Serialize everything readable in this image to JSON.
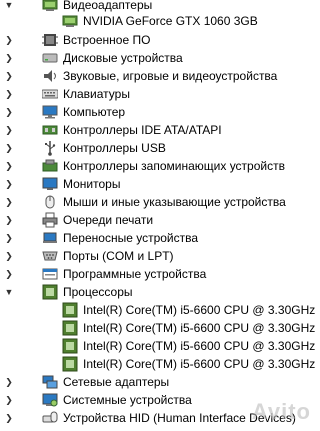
{
  "tree": {
    "top_group": {
      "label": "Видеоадаптеры",
      "child": "NVIDIA GeForce GTX 1060 3GB"
    },
    "items": [
      {
        "label": "Встроенное ПО",
        "icon": "firmware-icon"
      },
      {
        "label": "Дисковые устройства",
        "icon": "disk-drive-icon"
      },
      {
        "label": "Звуковые, игровые и видеоустройства",
        "icon": "speaker-icon"
      },
      {
        "label": "Клавиатуры",
        "icon": "keyboard-icon"
      },
      {
        "label": "Компьютер",
        "icon": "computer-icon"
      },
      {
        "label": "Контроллеры IDE ATA/ATAPI",
        "icon": "ide-controller-icon"
      },
      {
        "label": "Контроллеры USB",
        "icon": "usb-icon"
      },
      {
        "label": "Контроллеры запоминающих устройств",
        "icon": "storage-controller-icon"
      },
      {
        "label": "Мониторы",
        "icon": "monitor-icon"
      },
      {
        "label": "Мыши и иные указывающие устройства",
        "icon": "mouse-icon"
      },
      {
        "label": "Очереди печати",
        "icon": "printer-icon"
      },
      {
        "label": "Переносные устройства",
        "icon": "portable-device-icon"
      },
      {
        "label": "Порты (COM и LPT)",
        "icon": "port-icon"
      },
      {
        "label": "Программные устройства",
        "icon": "software-device-icon"
      }
    ],
    "processors": {
      "label": "Процессоры",
      "children": [
        "Intel(R) Core(TM) i5-6600 CPU @ 3.30GHz",
        "Intel(R) Core(TM) i5-6600 CPU @ 3.30GHz",
        "Intel(R) Core(TM) i5-6600 CPU @ 3.30GHz",
        "Intel(R) Core(TM) i5-6600 CPU @ 3.30GHz"
      ]
    },
    "after_items": [
      {
        "label": "Сетевые адаптеры",
        "icon": "network-adapter-icon"
      },
      {
        "label": "Системные устройства",
        "icon": "system-device-icon"
      },
      {
        "label": "Устройства HID (Human Interface Devices)",
        "icon": "hid-icon"
      }
    ]
  },
  "watermark": "Avito"
}
